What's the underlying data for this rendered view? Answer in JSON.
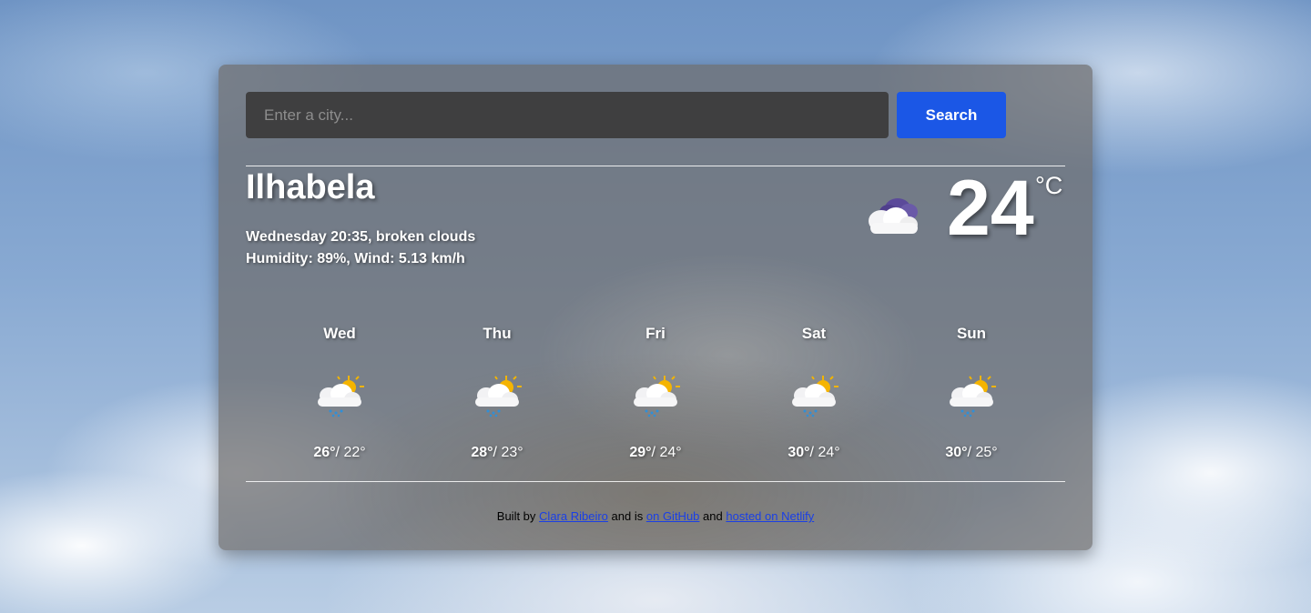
{
  "search": {
    "placeholder": "Enter a city...",
    "button_label": "Search"
  },
  "current": {
    "city": "Ilhabela",
    "datetime_description": "Wednesday 20:35, broken clouds",
    "humidity_wind": "Humidity: 89%, Wind: 5.13 km/h",
    "temperature": "24",
    "unit": "°C",
    "icon": "broken-clouds-icon"
  },
  "forecast": [
    {
      "day": "Wed",
      "max": "26°",
      "min": "/ 22°",
      "icon": "sun-cloud-rain-icon"
    },
    {
      "day": "Thu",
      "max": "28°",
      "min": "/ 23°",
      "icon": "sun-cloud-rain-icon"
    },
    {
      "day": "Fri",
      "max": "29°",
      "min": "/ 24°",
      "icon": "sun-cloud-rain-icon"
    },
    {
      "day": "Sat",
      "max": "30°",
      "min": "/ 24°",
      "icon": "sun-cloud-rain-icon"
    },
    {
      "day": "Sun",
      "max": "30°",
      "min": "/ 25°",
      "icon": "sun-cloud-rain-icon"
    }
  ],
  "footer": {
    "prefix": "Built by",
    "author_link": "Clara Ribeiro",
    "middle": "and is",
    "github_link": "on GitHub",
    "and": "and",
    "netlify_link": "hosted on Netlify"
  },
  "colors": {
    "search_button": "#1b57e6",
    "link": "#1a3fe6"
  }
}
